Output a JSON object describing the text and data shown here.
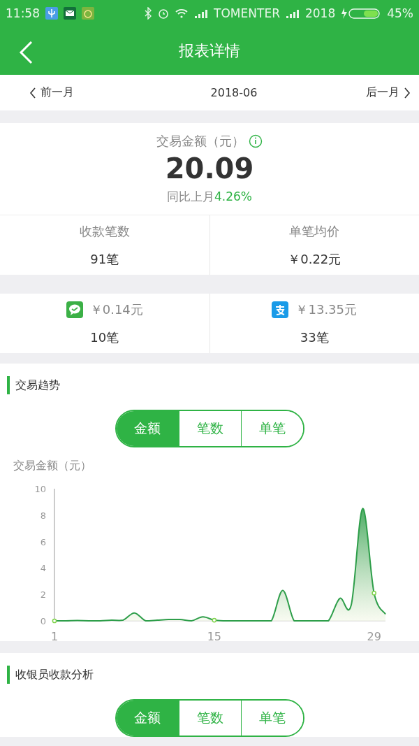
{
  "status_bar": {
    "time": "11:58",
    "carrier": "TOMENTER",
    "carrier2": "2018",
    "battery": "45%"
  },
  "header": {
    "title": "报表详情"
  },
  "month_nav": {
    "prev": "前一月",
    "current": "2018-06",
    "next": "后一月"
  },
  "summary": {
    "label": "交易金额（元）",
    "amount": "20.09",
    "compare_label": "同比上月",
    "compare_value": "4.26%",
    "stats": [
      {
        "label": "收款笔数",
        "value": "91笔"
      },
      {
        "label": "单笔均价",
        "value": "￥0.22元"
      }
    ]
  },
  "payments": [
    {
      "kind": "wechat",
      "amount": "￥0.14元",
      "count": "10笔"
    },
    {
      "kind": "alipay",
      "amount": "￥13.35元",
      "count": "33笔"
    }
  ],
  "trend": {
    "title": "交易趋势",
    "tabs": [
      {
        "label": "金额",
        "selected": true
      },
      {
        "label": "笔数",
        "selected": false
      },
      {
        "label": "单笔",
        "selected": false
      }
    ],
    "chart_data": {
      "type": "area",
      "ylabel": "交易金额（元）",
      "x": [
        1,
        2,
        3,
        4,
        5,
        6,
        7,
        8,
        9,
        10,
        11,
        12,
        13,
        14,
        15,
        16,
        17,
        18,
        19,
        20,
        21,
        22,
        23,
        24,
        25,
        26,
        27,
        28,
        29,
        30
      ],
      "series": [
        {
          "color": "#2e9e4a",
          "values": [
            0,
            0,
            0.02,
            0,
            0,
            0.05,
            0.05,
            0.6,
            0,
            0.05,
            0.1,
            0.1,
            0,
            0.3,
            0.05,
            0,
            0,
            0,
            0,
            0,
            2.3,
            0,
            0,
            0,
            0,
            1.7,
            1.2,
            8.5,
            2.1,
            0.5
          ]
        }
      ],
      "xlim": [
        1,
        30
      ],
      "ylim": [
        0,
        10
      ],
      "xticks": [
        1,
        15,
        29
      ],
      "yticks": [
        0,
        2,
        4,
        6,
        8,
        10
      ]
    }
  },
  "cashier": {
    "title": "收银员收款分析",
    "tabs": [
      {
        "label": "金额",
        "selected": true
      },
      {
        "label": "笔数",
        "selected": false
      },
      {
        "label": "单笔",
        "selected": false
      }
    ]
  }
}
